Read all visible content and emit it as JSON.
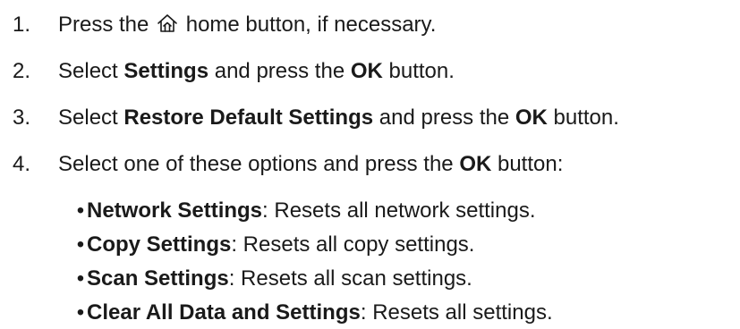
{
  "steps": [
    {
      "number": "1.",
      "pre": "Press the",
      "icon": "home-icon",
      "post": " home button, if necessary."
    },
    {
      "number": "2.",
      "pre": "Select ",
      "bold1": "Settings",
      "mid": " and press the ",
      "bold2": "OK",
      "post": " button."
    },
    {
      "number": "3.",
      "pre": "Select ",
      "bold1": "Restore Default Settings",
      "mid": " and press the ",
      "bold2": "OK",
      "post": " button."
    },
    {
      "number": "4.",
      "pre": "Select one of these options and press the ",
      "bold": "OK",
      "post": " button:"
    }
  ],
  "options": [
    {
      "bullet": "•",
      "name": "Network Settings",
      "desc": ": Resets all network settings."
    },
    {
      "bullet": "•",
      "name": "Copy Settings",
      "desc": ": Resets all copy settings."
    },
    {
      "bullet": "•",
      "name": "Scan Settings",
      "desc": ": Resets all scan settings."
    },
    {
      "bullet": "•",
      "name": "Clear All Data and Settings",
      "desc": ": Resets all settings."
    }
  ]
}
